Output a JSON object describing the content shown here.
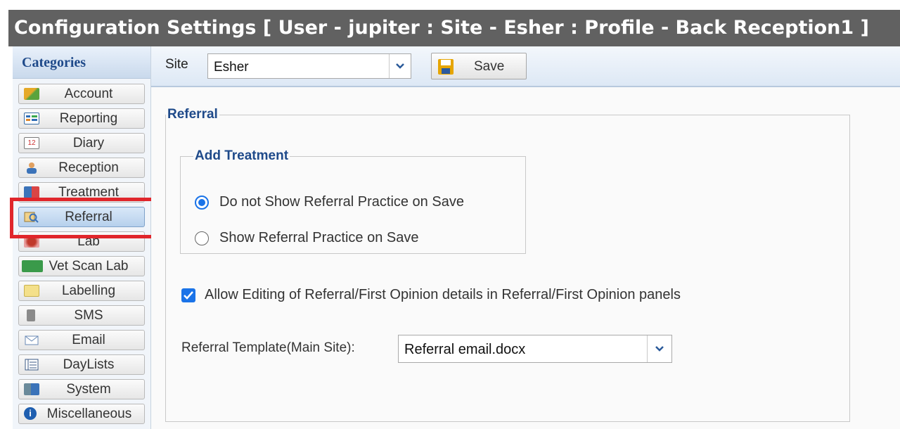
{
  "window": {
    "title": "Configuration Settings [ User - jupiter : Site - Esher : Profile - Back Reception1 ]"
  },
  "categories": {
    "header": "Categories",
    "items": [
      {
        "label": "Account",
        "icon": "account-icon"
      },
      {
        "label": "Reporting",
        "icon": "reporting-icon"
      },
      {
        "label": "Diary",
        "icon": "calendar-icon"
      },
      {
        "label": "Reception",
        "icon": "reception-icon"
      },
      {
        "label": "Treatment",
        "icon": "treatment-icon"
      },
      {
        "label": "Referral",
        "icon": "referral-icon",
        "selected": true
      },
      {
        "label": "Lab",
        "icon": "lab-icon"
      },
      {
        "label": "Vet Scan Lab",
        "icon": "vet-scan-lab-icon"
      },
      {
        "label": "Labelling",
        "icon": "labelling-icon"
      },
      {
        "label": "SMS",
        "icon": "sms-icon"
      },
      {
        "label": "Email",
        "icon": "email-icon"
      },
      {
        "label": "DayLists",
        "icon": "daylists-icon"
      },
      {
        "label": "System",
        "icon": "system-icon"
      },
      {
        "label": "Miscellaneous",
        "icon": "info-icon"
      }
    ]
  },
  "toolbar": {
    "site_label": "Site",
    "site_value": "Esher",
    "save_label": "Save"
  },
  "referral": {
    "legend": "Referral",
    "add_treatment": {
      "legend": "Add Treatment",
      "options": [
        {
          "label": "Do not Show Referral Practice on Save",
          "selected": true
        },
        {
          "label": "Show Referral Practice on Save",
          "selected": false
        }
      ]
    },
    "allow_editing": {
      "label": "Allow Editing of Referral/First Opinion details in Referral/First Opinion panels",
      "checked": true
    },
    "template": {
      "label": "Referral Template(Main Site):",
      "value": "Referral email.docx"
    }
  },
  "colors": {
    "accent": "#1a73e8",
    "highlight": "#e0262b",
    "titlebar": "#616161",
    "legend": "#1f4a8a"
  }
}
